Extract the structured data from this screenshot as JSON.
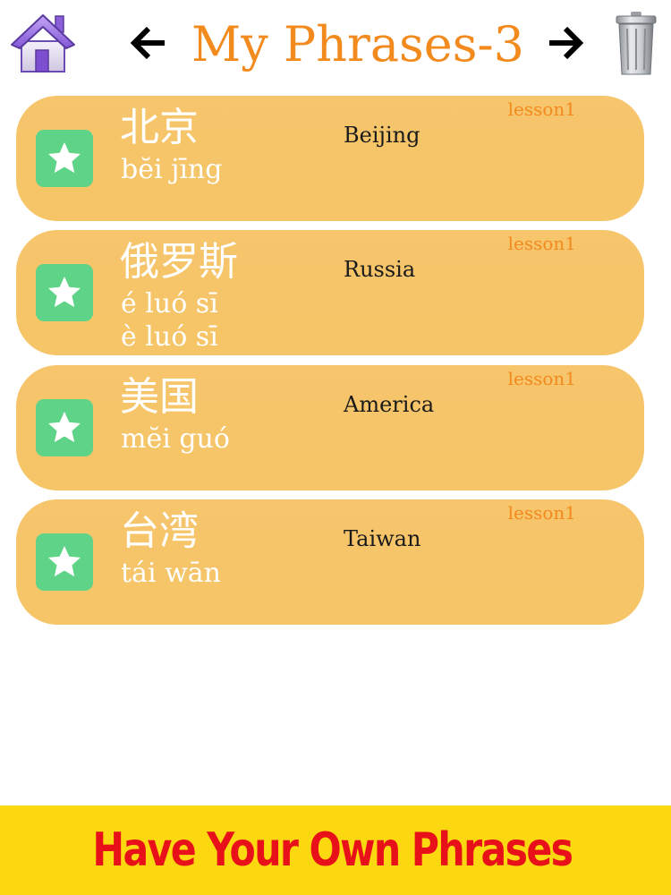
{
  "header": {
    "title": "My Phrases-3",
    "home_icon": "house-icon",
    "prev_icon": "arrow-left-icon",
    "next_icon": "arrow-right-icon",
    "trash_icon": "trash-can-icon"
  },
  "phrases": [
    {
      "hanzi": "北京",
      "pinyin": [
        "bĕi jīng"
      ],
      "meaning": "Beijing",
      "lesson": "lesson1"
    },
    {
      "hanzi": "俄罗斯",
      "pinyin": [
        "é luó sī",
        "è luó sī"
      ],
      "meaning": "Russia",
      "lesson": "lesson1"
    },
    {
      "hanzi": "美国",
      "pinyin": [
        "mĕi guó"
      ],
      "meaning": "America",
      "lesson": "lesson1"
    },
    {
      "hanzi": "台湾",
      "pinyin": [
        "tái wān"
      ],
      "meaning": "Taiwan",
      "lesson": "lesson1"
    }
  ],
  "banner": {
    "text": "Have Your Own Phrases"
  },
  "colors": {
    "title": "#f28a1e",
    "card": "#f6c56c",
    "star_button": "#5fd488",
    "banner_bg": "#fbd80f",
    "banner_text": "#e8111a"
  }
}
